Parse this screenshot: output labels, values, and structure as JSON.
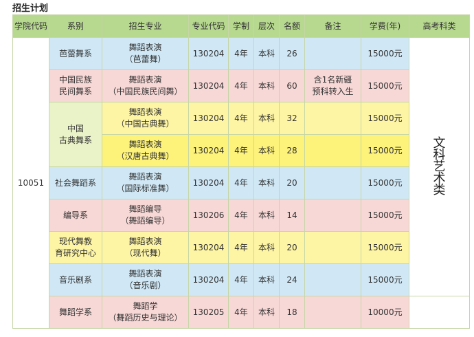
{
  "title": "招生计划",
  "headers": [
    "学院代码",
    "系别",
    "招生专业",
    "专业代码",
    "学制",
    "层次",
    "名额",
    "备注",
    "学费(年)",
    "高考科类"
  ],
  "college_code": "10051",
  "category": "文\n科\n艺\n术\n类",
  "rows": [
    {
      "dept": "芭蕾舞系",
      "major": "舞蹈表演\n（芭蕾舞）",
      "code": "130204",
      "years": "4年",
      "level": "本科",
      "quota": "26",
      "note": "",
      "fee": "15000元"
    },
    {
      "dept": "中国民族\n民间舞系",
      "major": "舞蹈表演\n（中国民族民间舞）",
      "code": "130204",
      "years": "4年",
      "level": "本科",
      "quota": "60",
      "note": "含1名新疆\n预科转入生",
      "fee": "15000元"
    },
    {
      "dept": "中国\n古典舞系",
      "major": "舞蹈表演\n（中国古典舞）",
      "code": "130204",
      "years": "4年",
      "level": "本科",
      "quota": "32",
      "note": "",
      "fee": "15000元"
    },
    {
      "dept": "",
      "major": "舞蹈表演\n（汉唐古典舞）",
      "code": "130204",
      "years": "4年",
      "level": "本科",
      "quota": "28",
      "note": "",
      "fee": "15000元"
    },
    {
      "dept": "社会舞蹈系",
      "major": "舞蹈表演\n（国际标准舞）",
      "code": "130204",
      "years": "4年",
      "level": "本科",
      "quota": "20",
      "note": "",
      "fee": "15000元"
    },
    {
      "dept": "编导系",
      "major": "舞蹈编导\n（舞蹈编导）",
      "code": "130206",
      "years": "4年",
      "level": "本科",
      "quota": "14",
      "note": "",
      "fee": "15000元"
    },
    {
      "dept": "现代舞教\n育研究中心",
      "major": "舞蹈表演\n（现代舞）",
      "code": "130204",
      "years": "4年",
      "level": "本科",
      "quota": "20",
      "note": "",
      "fee": "15000元"
    },
    {
      "dept": "音乐剧系",
      "major": "舞蹈表演\n（音乐剧）",
      "code": "130204",
      "years": "4年",
      "level": "本科",
      "quota": "24",
      "note": "",
      "fee": "15000元"
    },
    {
      "dept": "舞蹈学系",
      "major": "舞蹈学\n（舞蹈历史与理论）",
      "code": "130205",
      "years": "4年",
      "level": "本科",
      "quota": "18",
      "note": "",
      "fee": "10000元"
    }
  ]
}
